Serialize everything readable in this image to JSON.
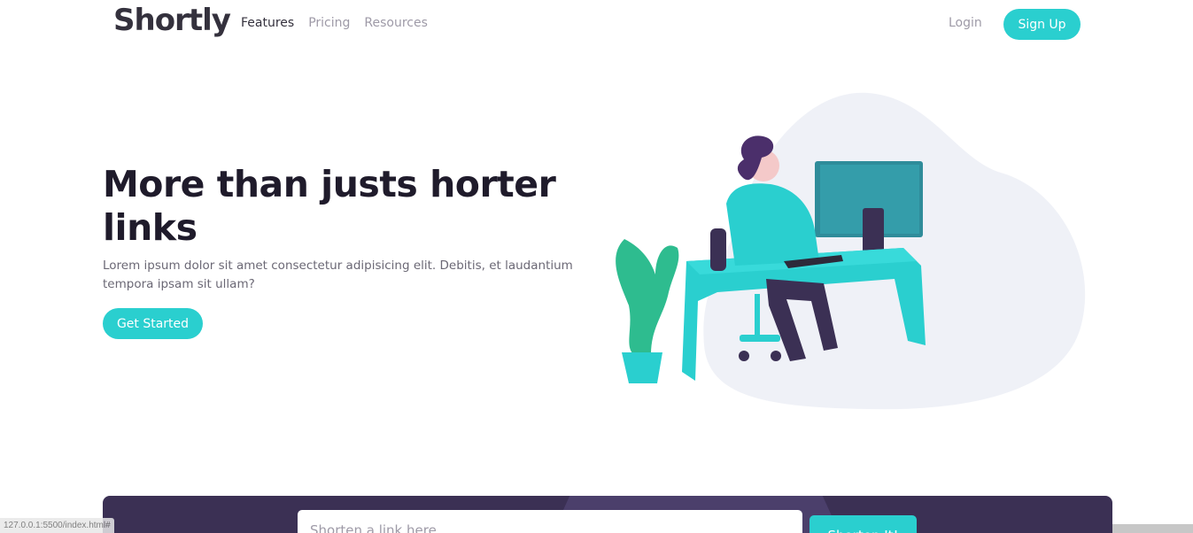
{
  "brand": {
    "logo": "Shortly",
    "accent": "#2acfcf",
    "dark_violet": "#3b3054"
  },
  "nav": {
    "links": [
      "Features",
      "Pricing",
      "Resources"
    ],
    "login": "Login",
    "signup": "Sign Up"
  },
  "hero": {
    "title": "More than justs horter links",
    "text": "Lorem ipsum dolor sit amet consectetur adipisicing elit. Debitis, et laudantium tempora ipsam sit ullam?",
    "cta": "Get Started",
    "illustration": "person-working-at-desk-illustration"
  },
  "shorten": {
    "placeholder": "Shorten a link here...",
    "button": "Shorten It!"
  },
  "status_bar": {
    "url": "127.0.0.1:5500/index.html#"
  }
}
